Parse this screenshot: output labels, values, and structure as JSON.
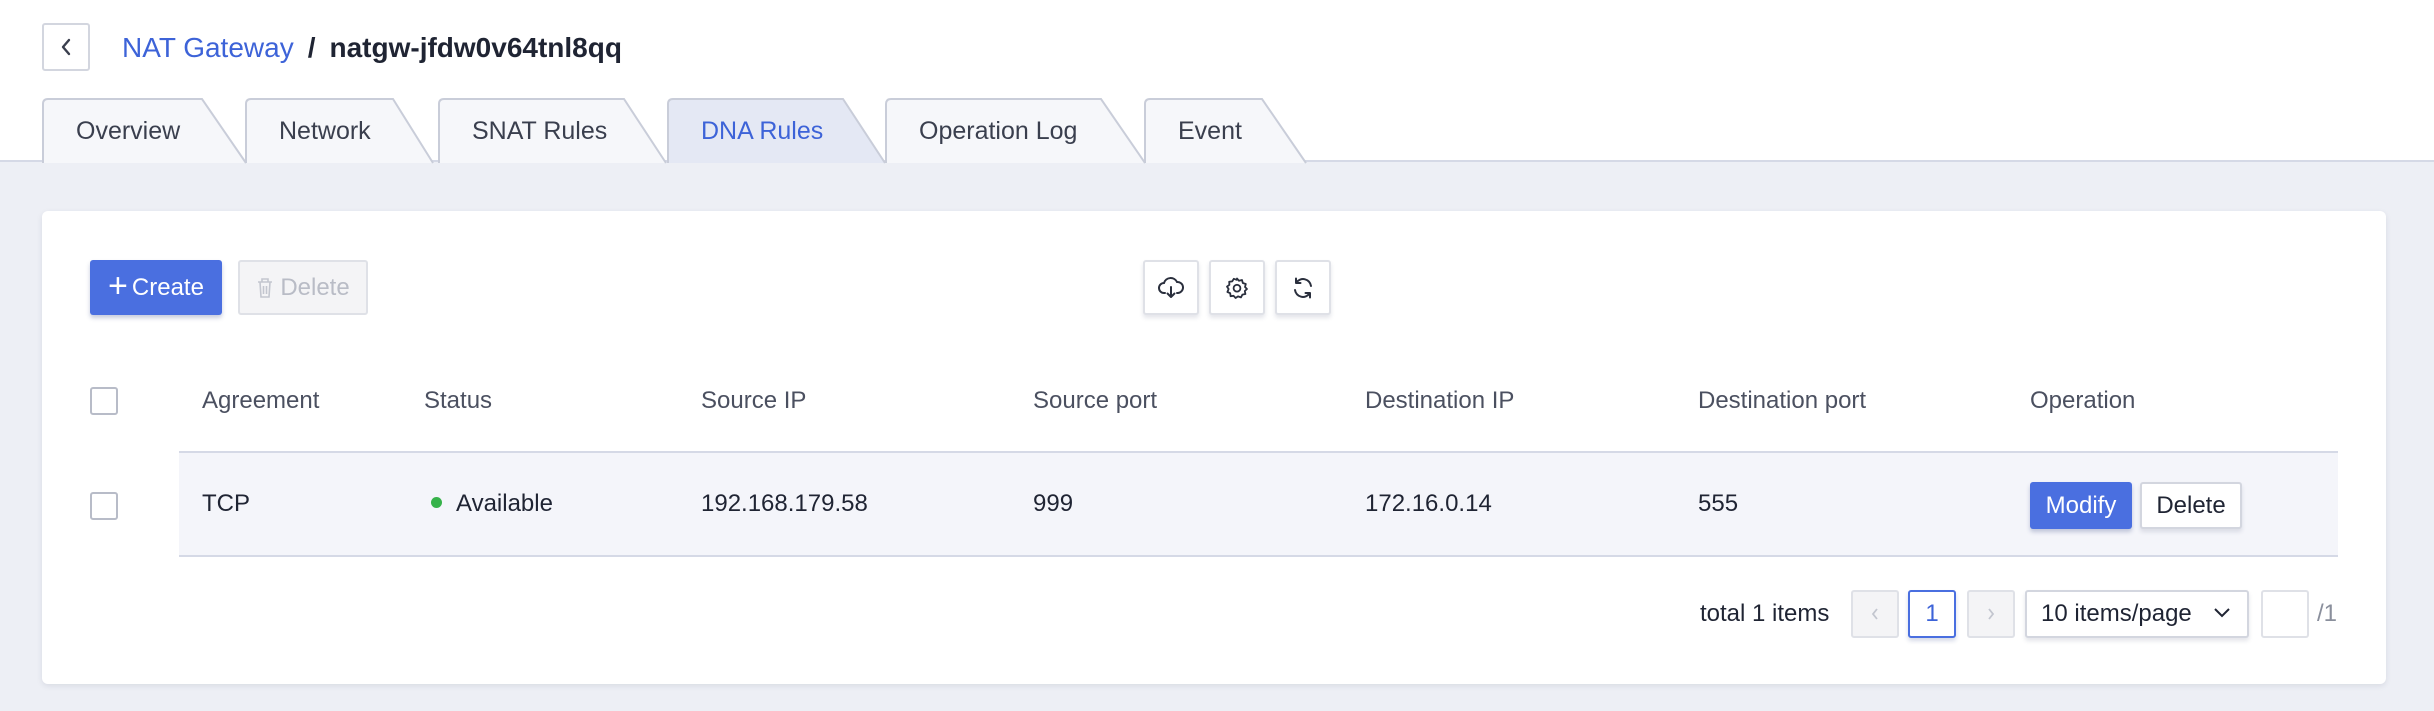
{
  "breadcrumb": {
    "parent": "NAT Gateway",
    "separator": "/",
    "current": "natgw-jfdw0v64tnl8qq"
  },
  "tabs": [
    {
      "label": "Overview",
      "active": false
    },
    {
      "label": "Network",
      "active": false
    },
    {
      "label": "SNAT Rules",
      "active": false
    },
    {
      "label": "DNA Rules",
      "active": true
    },
    {
      "label": "Operation Log",
      "active": false
    },
    {
      "label": "Event",
      "active": false
    }
  ],
  "toolbar": {
    "create_plus": "+",
    "create_label": "Create",
    "delete_label": "Delete",
    "icons": [
      "cloud-download-icon",
      "gear-icon",
      "refresh-icon"
    ]
  },
  "table": {
    "columns": [
      "Agreement",
      "Status",
      "Source IP",
      "Source port",
      "Destination IP",
      "Destination port",
      "Operation"
    ],
    "rows": [
      {
        "agreement": "TCP",
        "status": "Available",
        "status_color": "#36b24a",
        "source_ip": "192.168.179.58",
        "source_port": "999",
        "destination_ip": "172.16.0.14",
        "destination_port": "555",
        "modify_label": "Modify",
        "delete_label": "Delete"
      }
    ]
  },
  "pagination": {
    "total_text": "total 1 items",
    "current_page": "1",
    "page_size": "10 items/page",
    "total_pages": "/1"
  },
  "colors": {
    "accent": "#4a6fe0",
    "link": "#3d63d8",
    "background": "#edeff5"
  }
}
